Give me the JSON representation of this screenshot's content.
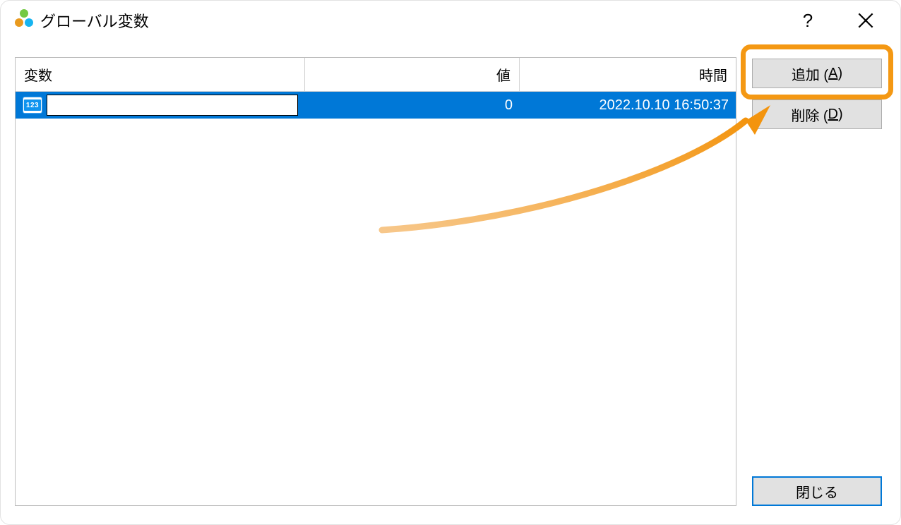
{
  "window": {
    "title": "グローバル変数"
  },
  "grid": {
    "headers": {
      "variable": "変数",
      "value": "値",
      "time": "時間"
    },
    "row": {
      "icon_text": "123",
      "name_value": "",
      "value": "0",
      "time": "2022.10.10 16:50:37"
    }
  },
  "buttons": {
    "add": {
      "label": "追加 (",
      "hotkey": "A",
      "suffix": ")"
    },
    "delete": {
      "label": "削除 (",
      "hotkey": "D",
      "suffix": ")"
    },
    "close": {
      "label": "閉じる"
    }
  }
}
